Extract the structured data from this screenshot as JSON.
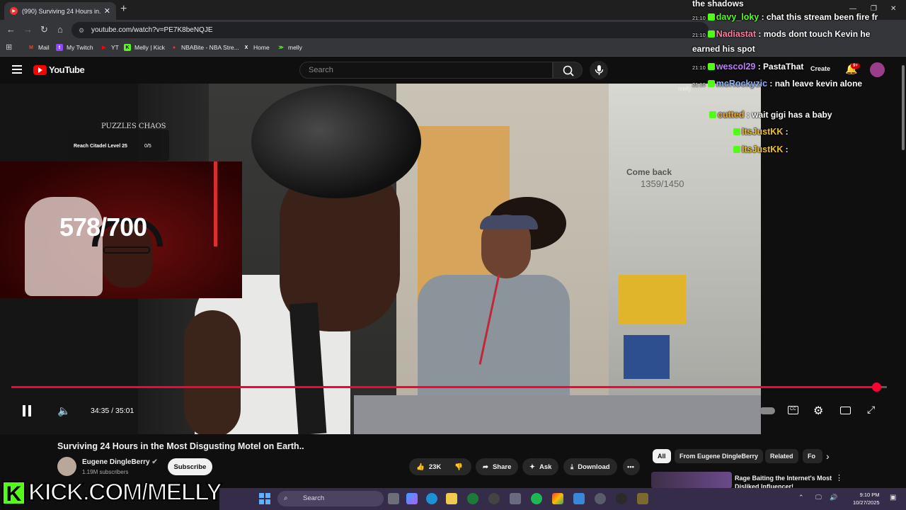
{
  "browser": {
    "tab_title": "(990) Surviving 24 Hours in...",
    "url": "youtube.com/watch?v=PE7K8beNQJE",
    "bookmarks": [
      "Mail",
      "My Twitch",
      "YT",
      "Melly | Kick",
      "NBABite - NBA Stre...",
      "Home",
      "melly"
    ]
  },
  "youtube": {
    "logo_text": "YouTube",
    "search_placeholder": "Search",
    "create_label": "Create",
    "notif_badge": "9+",
    "video_title": "Surviving 24 Hours in the Most Disgusting Motel on Earth..",
    "channel_name": "Eugene DingleBerry",
    "subscribers": "1.19M subscribers",
    "subscribe_label": "Subscribe",
    "likes": "23K",
    "share_label": "Share",
    "ask_label": "Ask",
    "download_label": "Download",
    "chips": [
      "All",
      "From Eugene DingleBerry",
      "Related",
      "Fo"
    ],
    "reco_title": "Rage Baiting the Internet's Most Disliked Influencer!"
  },
  "player": {
    "time": "34:35 / 35:01",
    "progress": 0.988
  },
  "stream_overlay": {
    "achievement_logo": "PUZZLES CHAOS",
    "achievement_text": "Reach Citadel Level 25",
    "achievement_count": "0/5",
    "counter": "578/700",
    "goal_title": "Come back",
    "goal_count": "1359/1450",
    "kick_text": "KICK.COM/MELLY",
    "small_chat_name": "melly"
  },
  "chat": [
    {
      "ts": "",
      "user": "",
      "msg": "the shadows",
      "color": "#ffffff"
    },
    {
      "ts": "21:10",
      "user": "davy_loky",
      "msg": ": chat this stream been fire fr",
      "color": "#53fc18"
    },
    {
      "ts": "21:10",
      "user": "Nadiastat",
      "msg": ": mods dont touch Kevin he",
      "color": "#ff7b9c"
    },
    {
      "ts": "",
      "user": "",
      "msg": "earned his spot",
      "color": "#ffffff"
    },
    {
      "ts": "21:10",
      "user": "wescol29",
      "msg": ": PastaThat",
      "color": "#c07bff"
    },
    {
      "ts": "21:10",
      "user": "mcRockyzic",
      "msg": ": nah leave kevin alone",
      "color": "#8fb3ff"
    },
    {
      "ts": "",
      "user": "cutted",
      "msg": ": wait gigi has a baby",
      "color": "#f0a830"
    },
    {
      "ts": "",
      "user": "ItsJustKK",
      "msg": ":",
      "color": "#f0c020"
    },
    {
      "ts": "",
      "user": "ItsJustKK",
      "msg": ":",
      "color": "#f0c020"
    }
  ],
  "taskbar": {
    "search": "Search",
    "time": "9:10 PM",
    "date": "10/27/2025"
  },
  "colors": {
    "yt_red": "#ff0033",
    "kick_green": "#53fc18",
    "taskbar": "#342c49"
  }
}
